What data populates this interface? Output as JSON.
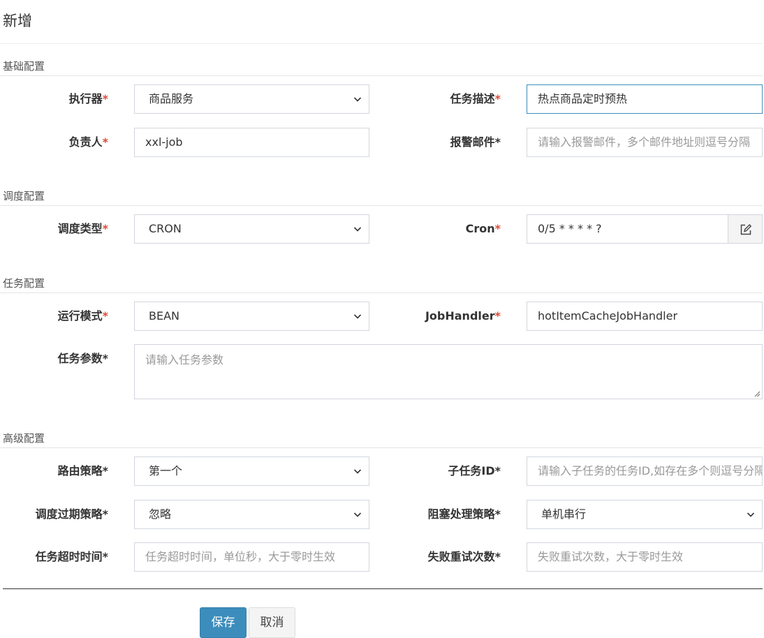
{
  "header": {
    "title": "新增"
  },
  "sections": {
    "basic": "基础配置",
    "schedule": "调度配置",
    "task": "任务配置",
    "advanced": "高级配置"
  },
  "fields": {
    "executor": {
      "label": "执行器",
      "required_mark": "*",
      "value": "商品服务"
    },
    "job_desc": {
      "label": "任务描述",
      "required_mark": "*",
      "value": "热点商品定时预热"
    },
    "author": {
      "label": "负责人",
      "required_mark": "*",
      "value": "xxl-job"
    },
    "alarm_email": {
      "label": "报警邮件*",
      "placeholder": "请输入报警邮件，多个邮件地址则逗号分隔"
    },
    "schedule_type": {
      "label": "调度类型",
      "required_mark": "*",
      "value": "CRON"
    },
    "cron": {
      "label": "Cron",
      "required_mark": "*",
      "value": "0/5 * * * * ?"
    },
    "glue_type": {
      "label": "运行模式",
      "required_mark": "*",
      "value": "BEAN"
    },
    "job_handler": {
      "label": "JobHandler",
      "required_mark": "*",
      "value": "hotItemCacheJobHandler"
    },
    "job_param": {
      "label": "任务参数*",
      "placeholder": "请输入任务参数"
    },
    "route_strategy": {
      "label": "路由策略*",
      "value": "第一个"
    },
    "child_job_id": {
      "label": "子任务ID*",
      "placeholder": "请输入子任务的任务ID,如存在多个则逗号分隔"
    },
    "misfire_strategy": {
      "label": "调度过期策略*",
      "value": "忽略"
    },
    "block_strategy": {
      "label": "阻塞处理策略*",
      "value": "单机串行"
    },
    "timeout": {
      "label": "任务超时时间*",
      "placeholder": "任务超时时间，单位秒，大于零时生效"
    },
    "fail_retry": {
      "label": "失败重试次数*",
      "placeholder": "失败重试次数，大于零时生效"
    }
  },
  "buttons": {
    "save": "保存",
    "cancel": "取消"
  },
  "colors": {
    "primary": "#3c8dbc",
    "required": "#dd4b39",
    "border": "#d2d6de"
  },
  "icons": {
    "select": "chevron-down-icon",
    "cron_edit": "edit-icon"
  }
}
